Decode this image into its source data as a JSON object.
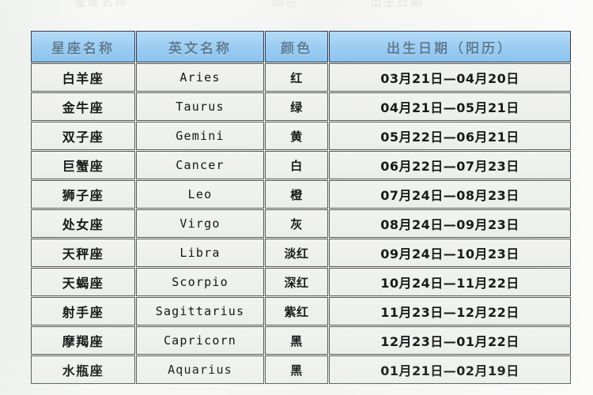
{
  "top_remnant": {
    "fragments": [
      "星座名称",
      "颜色",
      "出生日期"
    ]
  },
  "table": {
    "headers": [
      {
        "key": "name",
        "label": "星座名称"
      },
      {
        "key": "en",
        "label": "英文名称"
      },
      {
        "key": "color",
        "label": "颜色"
      },
      {
        "key": "date",
        "label": "出生日期（阳历）"
      }
    ],
    "rows": [
      {
        "name": "白羊座",
        "en": "Aries",
        "color": "红",
        "date": "03月21日—04月20日"
      },
      {
        "name": "金牛座",
        "en": "Taurus",
        "color": "绿",
        "date": "04月21日—05月21日"
      },
      {
        "name": "双子座",
        "en": "Gemini",
        "color": "黄",
        "date": "05月22日—06月21日"
      },
      {
        "name": "巨蟹座",
        "en": "Cancer",
        "color": "白",
        "date": "06月22日—07月23日"
      },
      {
        "name": "狮子座",
        "en": "Leo",
        "color": "橙",
        "date": "07月24日—08月23日"
      },
      {
        "name": "处女座",
        "en": "Virgo",
        "color": "灰",
        "date": "08月24日—09月23日"
      },
      {
        "name": "天秤座",
        "en": "Libra",
        "color": "淡红",
        "date": "09月24日—10月23日"
      },
      {
        "name": "天蝎座",
        "en": "Scorpio",
        "color": "深红",
        "date": "10月24日—11月22日"
      },
      {
        "name": "射手座",
        "en": "Sagittarius",
        "color": "紫红",
        "date": "11月23日—12月22日"
      },
      {
        "name": "摩羯座",
        "en": "Capricorn",
        "color": "黑",
        "date": "12月23日—01月22日"
      },
      {
        "name": "水瓶座",
        "en": "Aquarius",
        "color": "黑",
        "date": "01月21日—02月19日"
      }
    ]
  },
  "colors": {
    "header_fill": "#9ccdf2",
    "header_text": "#5b7d96",
    "header_border": "#2b3a50",
    "cell_fill": "#f0f1ee",
    "cell_border": "#555a55",
    "cell_text": "#171a18",
    "page_background": "#f4f5f3"
  }
}
